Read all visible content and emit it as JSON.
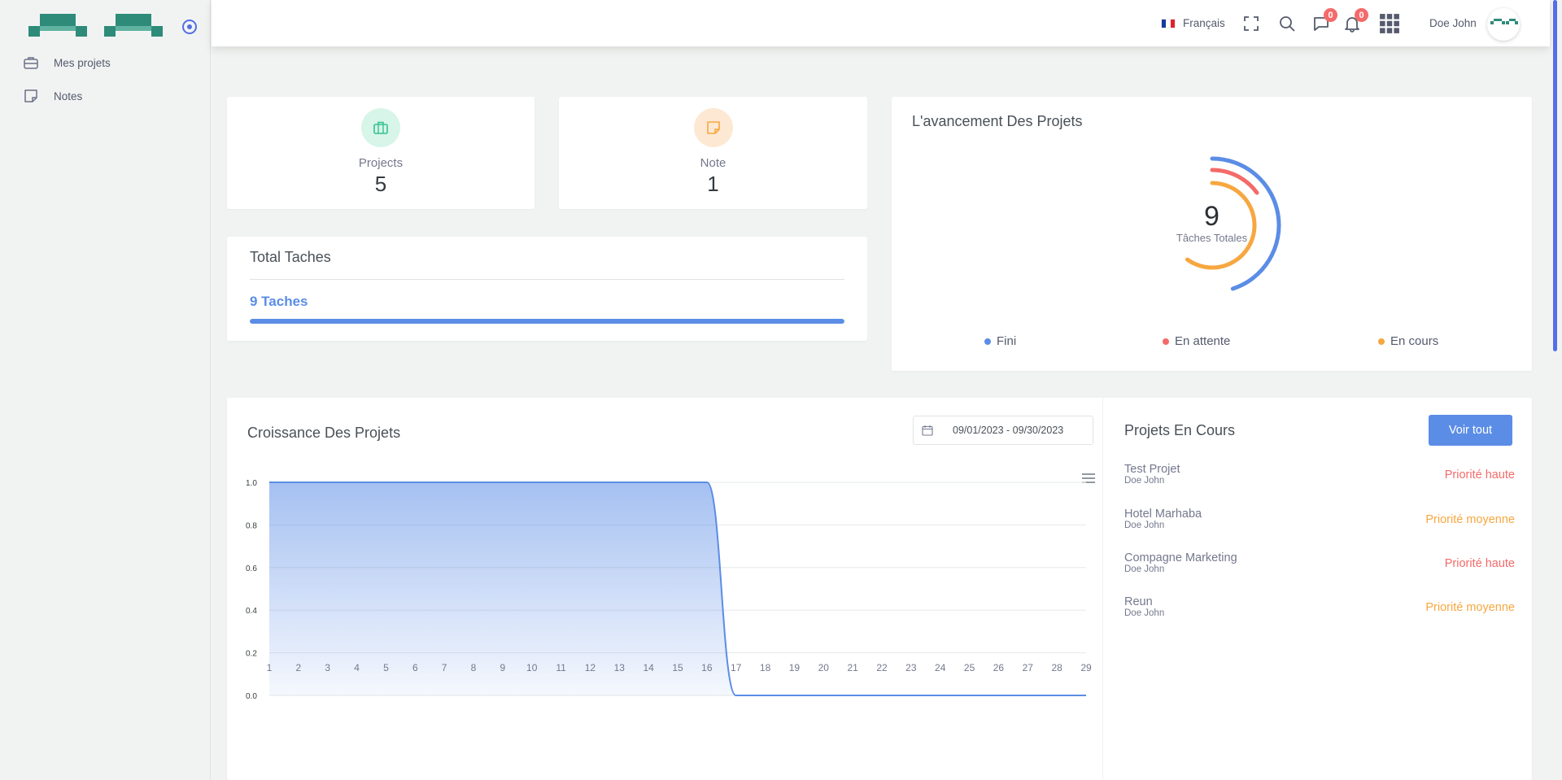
{
  "sidebar": {
    "items": [
      {
        "label": "Mes projets",
        "icon": "briefcase-icon"
      },
      {
        "label": "Notes",
        "icon": "note-icon"
      }
    ]
  },
  "topbar": {
    "language": "Français",
    "messages_count": "0",
    "notifications_count": "0",
    "user_name": "Doe John"
  },
  "stats": [
    {
      "label": "Projects",
      "value": "5",
      "icon": "briefcase-icon",
      "color": "#34c38f"
    },
    {
      "label": "Note",
      "value": "1",
      "icon": "note-icon",
      "color": "#f1b44c"
    }
  ],
  "total_tasks": {
    "title": "Total Taches",
    "value_label": "9 Taches",
    "progress": 1.0
  },
  "progress_card": {
    "title": "L'avancement Des Projets",
    "total": "9",
    "total_label": "Tâches Totales",
    "series": [
      {
        "name": "Fini",
        "color": "#5b8de6",
        "fraction": 0.45
      },
      {
        "name": "En attente",
        "color": "#f46a6a",
        "fraction": 0.15
      },
      {
        "name": "En cours",
        "color": "#f7a740",
        "fraction": 0.6
      }
    ]
  },
  "growth_card": {
    "title": "Croissance Des Projets",
    "date_range": "09/01/2023 - 09/30/2023"
  },
  "chart_data": {
    "type": "area",
    "title": "Croissance Des Projets",
    "x": [
      1,
      2,
      3,
      4,
      5,
      6,
      7,
      8,
      9,
      10,
      11,
      12,
      13,
      14,
      15,
      16,
      17,
      18,
      19,
      20,
      21,
      22,
      23,
      24,
      25,
      26,
      27,
      28,
      29
    ],
    "series": [
      {
        "values": [
          1,
          1,
          1,
          1,
          1,
          1,
          1,
          1,
          1,
          1,
          1,
          1,
          1,
          1,
          1,
          1,
          0,
          0,
          0,
          0,
          0,
          0,
          0,
          0,
          0,
          0,
          0,
          0,
          0
        ]
      }
    ],
    "yticks": [
      "0.0",
      "0.2",
      "0.4",
      "0.6",
      "0.8",
      "1.0"
    ],
    "ylim": [
      0,
      1
    ],
    "grid": true,
    "color": "#5b8de6"
  },
  "ongoing": {
    "title": "Projets En Cours",
    "button": "Voir tout",
    "projects": [
      {
        "name": "Test Projet",
        "owner": "Doe John",
        "priority": "Priorité haute",
        "color": "#f46a6a"
      },
      {
        "name": "Hotel Marhaba",
        "owner": "Doe John",
        "priority": "Priorité moyenne",
        "color": "#f7a740"
      },
      {
        "name": "Compagne Marketing",
        "owner": "Doe John",
        "priority": "Priorité haute",
        "color": "#f46a6a"
      },
      {
        "name": "Reun",
        "owner": "Doe John",
        "priority": "Priorité moyenne",
        "color": "#f7a740"
      }
    ]
  }
}
